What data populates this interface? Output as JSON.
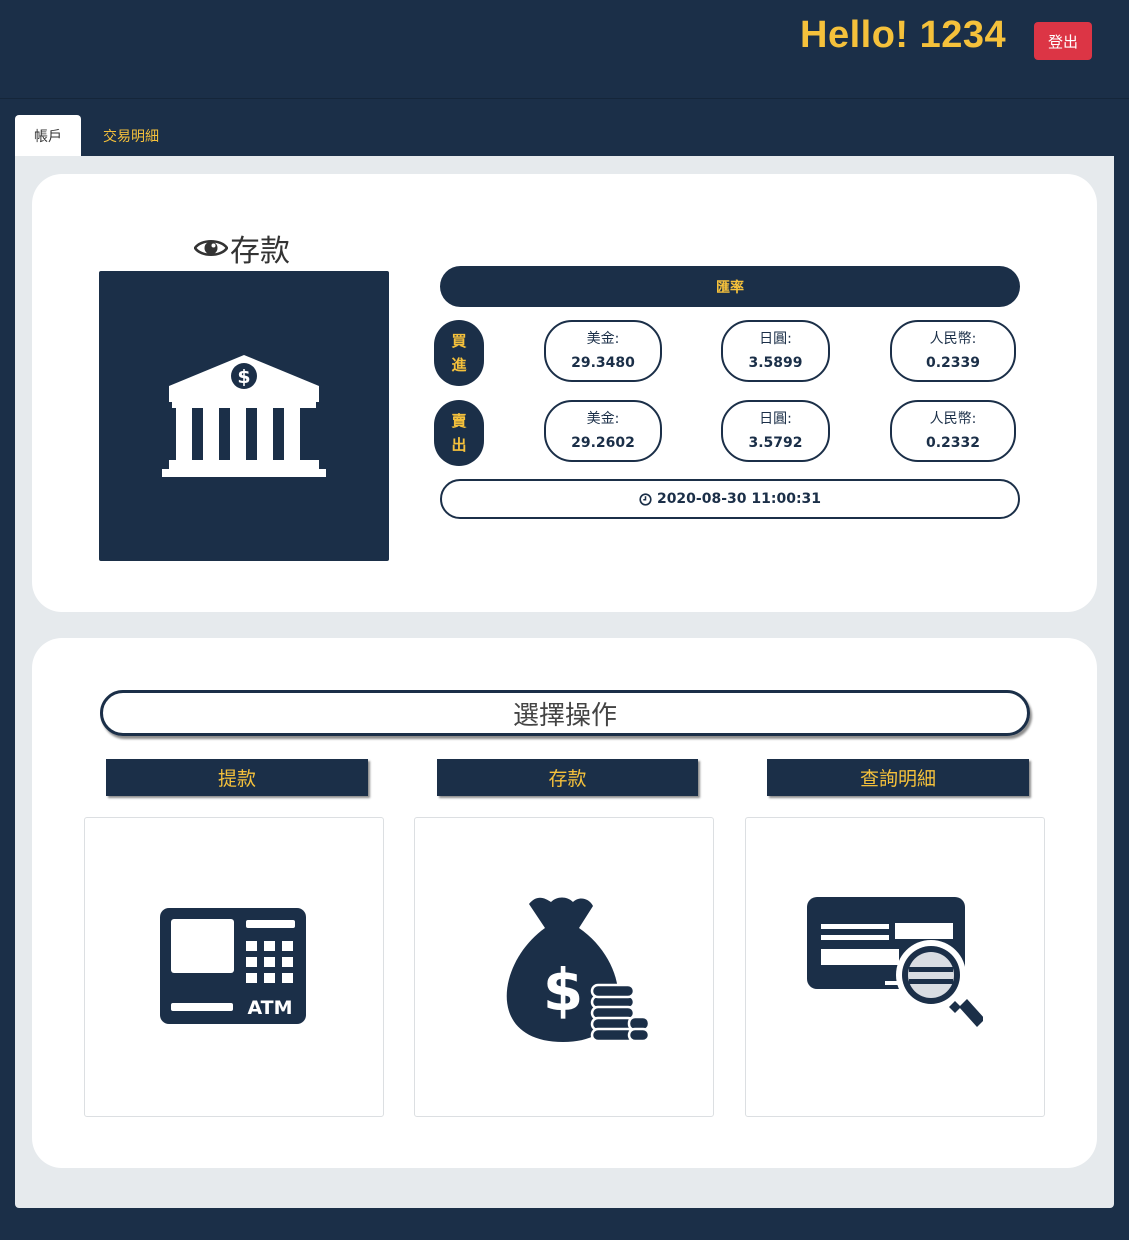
{
  "header": {
    "greeting": "Hello! 1234",
    "logout_label": "登出"
  },
  "tabs": [
    {
      "label": "帳戶",
      "active": true
    },
    {
      "label": "交易明細",
      "active": false
    }
  ],
  "account": {
    "deposit_title": "存款",
    "exchange": {
      "title": "匯率",
      "buy_label": [
        "買",
        "進"
      ],
      "sell_label": [
        "賣",
        "出"
      ],
      "buy": [
        {
          "currency": "美金:",
          "value": "29.3480"
        },
        {
          "currency": "日圓:",
          "value": "3.5899"
        },
        {
          "currency": "人民幣:",
          "value": "0.2339"
        }
      ],
      "sell": [
        {
          "currency": "美金:",
          "value": "29.2602"
        },
        {
          "currency": "日圓:",
          "value": "3.5792"
        },
        {
          "currency": "人民幣:",
          "value": "0.2332"
        }
      ],
      "timestamp": "2020-08-30 11:00:31"
    }
  },
  "operations": {
    "title": "選擇操作",
    "items": [
      {
        "label": "提款",
        "icon": "atm-icon"
      },
      {
        "label": "存款",
        "icon": "money-bag-icon"
      },
      {
        "label": "查詢明細",
        "icon": "card-search-icon"
      }
    ]
  },
  "colors": {
    "navy": "#1b2f48",
    "gold": "#f5c13b",
    "danger": "#dc3545",
    "panel": "#e6eaed"
  }
}
